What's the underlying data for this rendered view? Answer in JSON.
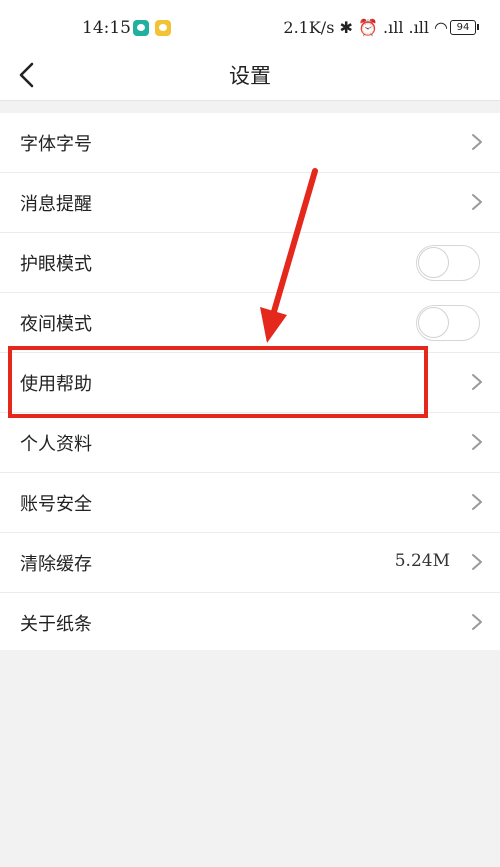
{
  "status_bar": {
    "time": "14:15",
    "right_text": "2.1K/s ✱ ⏰ .ıll .ıll ◠",
    "battery": "94"
  },
  "header": {
    "title": "设置"
  },
  "settings": {
    "items": [
      {
        "label": "字体字号",
        "control": "chevron"
      },
      {
        "label": "消息提醒",
        "control": "chevron"
      },
      {
        "label": "护眼模式",
        "control": "toggle",
        "enabled": false
      },
      {
        "label": "夜间模式",
        "control": "toggle",
        "enabled": false
      },
      {
        "label": "使用帮助",
        "control": "chevron",
        "highlighted": true
      },
      {
        "label": "个人资料",
        "control": "chevron"
      },
      {
        "label": "账号安全",
        "control": "chevron"
      },
      {
        "label": "清除缓存",
        "control": "chevron",
        "value": "5.24M"
      },
      {
        "label": "关于纸条",
        "control": "chevron"
      }
    ]
  },
  "colors": {
    "annotation": "#e4281b",
    "background": "#f2f2f2"
  }
}
